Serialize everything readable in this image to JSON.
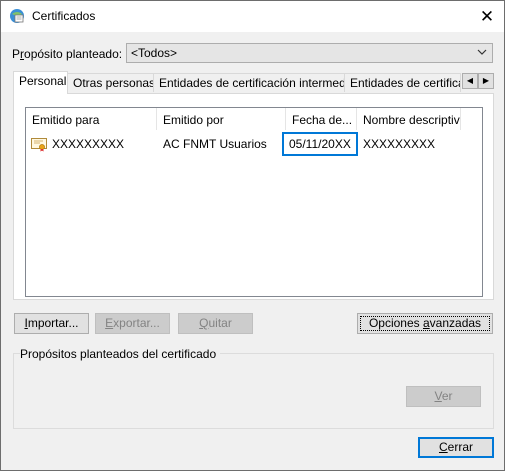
{
  "window": {
    "title": "Certificados",
    "close_glyph": "✕",
    "title_icon": "certificate-window-icon"
  },
  "purpose": {
    "label_prefix": "P",
    "label_accel": "r",
    "label_rest": "opósito planteado:",
    "selected": "<Todos>"
  },
  "tabs": [
    {
      "label": "Personal",
      "active": true
    },
    {
      "label": "Otras personas",
      "active": false
    },
    {
      "label": "Entidades de certificación intermedias",
      "active": false
    },
    {
      "label": "Entidades de certificaci",
      "active": false
    }
  ],
  "tab_scroll": {
    "left": "◀",
    "right": "▶"
  },
  "list": {
    "columns": [
      "Emitido para",
      "Emitido por",
      "Fecha de...",
      "Nombre descriptivo"
    ],
    "rows": [
      {
        "issued_to": "XXXXXXXXX",
        "issued_by": "AC FNMT Usuarios",
        "expiration": "05/11/20XX",
        "friendly_name": "XXXXXXXXX"
      }
    ]
  },
  "buttons": {
    "import": {
      "accel": "I",
      "rest": "mportar..."
    },
    "export": {
      "accel": "E",
      "rest": "xportar..."
    },
    "remove": {
      "accel": "Q",
      "rest": "uitar"
    },
    "advanced": {
      "pre": "Opciones ",
      "accel": "a",
      "rest": "vanzadas"
    },
    "view": {
      "accel": "V",
      "rest": "er"
    },
    "close": {
      "accel": "C",
      "rest": "errar"
    }
  },
  "purposes_group": {
    "title": "Propósitos planteados del certificado"
  },
  "colors": {
    "accent": "#0078d7",
    "dialog_bg": "#f0f0f0",
    "disabled_text": "#838383"
  }
}
